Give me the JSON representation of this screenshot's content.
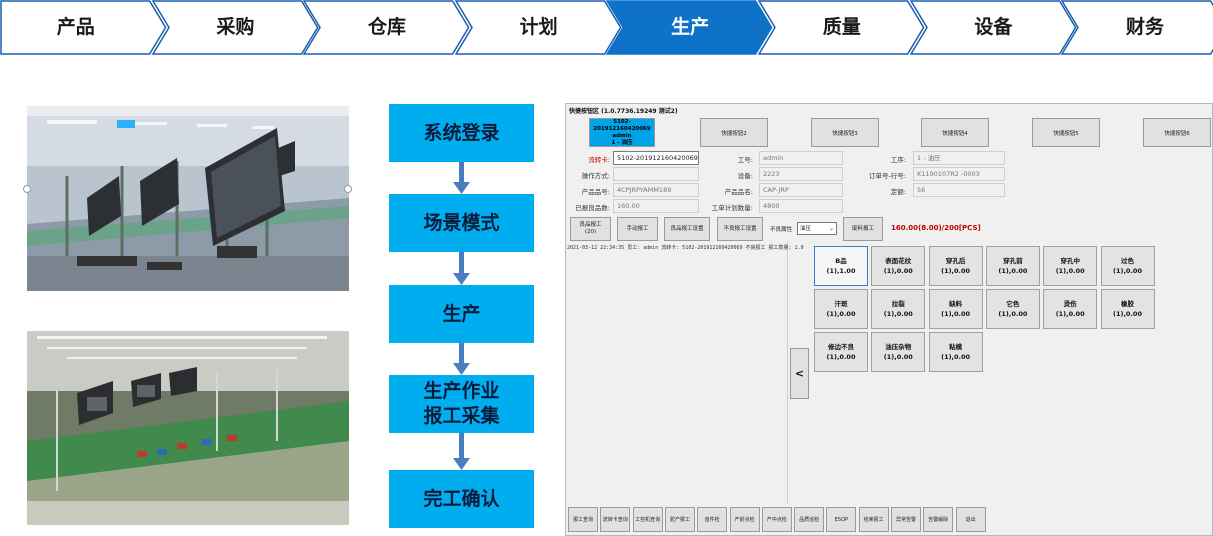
{
  "process_steps": [
    {
      "label": "产品",
      "active": false
    },
    {
      "label": "采购",
      "active": false
    },
    {
      "label": "仓库",
      "active": false
    },
    {
      "label": "计划",
      "active": false
    },
    {
      "label": "生产",
      "active": true
    },
    {
      "label": "质量",
      "active": false
    },
    {
      "label": "设备",
      "active": false
    },
    {
      "label": "财务",
      "active": false
    }
  ],
  "flow_steps": [
    {
      "label": "系统登录"
    },
    {
      "label": "场景模式"
    },
    {
      "label": "生产"
    },
    {
      "label": "生产作业\n报工采集"
    },
    {
      "label": "完工确认"
    }
  ],
  "screen": {
    "title": "快捷按钮区 (1.0.7736.19249 测试2)",
    "quick_buttons": [
      {
        "line1": "5102-201912160420069",
        "line2": "admin",
        "line3": "1 - 油压",
        "selected": true
      },
      {
        "label": "快捷按钮2"
      },
      {
        "label": "快捷按钮3"
      },
      {
        "label": "快捷按钮4"
      },
      {
        "label": "快捷按钮5"
      },
      {
        "label": "快捷按钮6"
      }
    ],
    "fields": {
      "flow_card_label": "流转卡:",
      "flow_card_value": "5102-201912160420069",
      "employee_label": "工号:",
      "employee_value": "admin",
      "process_label": "工序:",
      "process_value": "1 - 油压",
      "op_mode_label": "操作方式:",
      "op_mode_value": "",
      "equipment_label": "设备:",
      "equipment_value": "2223",
      "order_label": "订单号-行号:",
      "order_value": "K1190107R2 -0003",
      "product_code_label": "产品品号:",
      "product_code_value": "4CPJRPYAMM189",
      "product_name_label": "产品品名:",
      "product_name_value": "CAP-JRP",
      "quota_label": "定额:",
      "quota_value": "56",
      "reported_label": "已报良品数:",
      "reported_value": "160.00",
      "plan_label": "工单计划数量:",
      "plan_value": "4800"
    },
    "actions": {
      "good_report_line1": "良品报工",
      "good_report_line2": "(20)",
      "manual_report": "手动报工",
      "good_settings": "良品报工设置",
      "defect_settings": "不良报工设置",
      "defect_attr_label": "不良属性",
      "defect_attr_value": "油压",
      "scrap_report": "废料报工",
      "total": "160.00(8.00)/200[PCS]"
    },
    "log_line": "2021-03-12 22:34:35 员工: admin 流转卡: 5102-201912160420069 不良报工 报工数量: 1.0",
    "back_button": "<",
    "defects": [
      {
        "name": "B品",
        "count": "(1),1.00",
        "selected": true
      },
      {
        "name": "表面花纹",
        "count": "(1),0.00"
      },
      {
        "name": "穿孔后",
        "count": "(1),0.00"
      },
      {
        "name": "穿孔前",
        "count": "(1),0.00"
      },
      {
        "name": "穿孔中",
        "count": "(1),0.00"
      },
      {
        "name": "过色",
        "count": "(1),0.00"
      },
      {
        "name": "汗斑",
        "count": "(1),0.00"
      },
      {
        "name": "拉裂",
        "count": "(1),0.00"
      },
      {
        "name": "缺料",
        "count": "(1),0.00"
      },
      {
        "name": "它色",
        "count": "(1),0.00"
      },
      {
        "name": "烫伤",
        "count": "(1),0.00"
      },
      {
        "name": "橡胶",
        "count": "(1),0.00"
      },
      {
        "name": "修边不良",
        "count": "(1),0.00"
      },
      {
        "name": "油压杂物",
        "count": "(1),0.00"
      },
      {
        "name": "粘模",
        "count": "(1),0.00"
      }
    ],
    "bottom_buttons": [
      "报工查询",
      "流转卡查询",
      "工控机查询",
      "驼产报工",
      "首件检",
      "产前点检",
      "产中点检",
      "品质巡检",
      "ESOP",
      "结束报工",
      "异常告警",
      "告警解除",
      "退出"
    ]
  },
  "colors": {
    "active_step": "#0e73c8",
    "flow_box": "#00aeef",
    "flow_arrow": "#4a7dc0",
    "selected_quick": "#00a2e8"
  }
}
